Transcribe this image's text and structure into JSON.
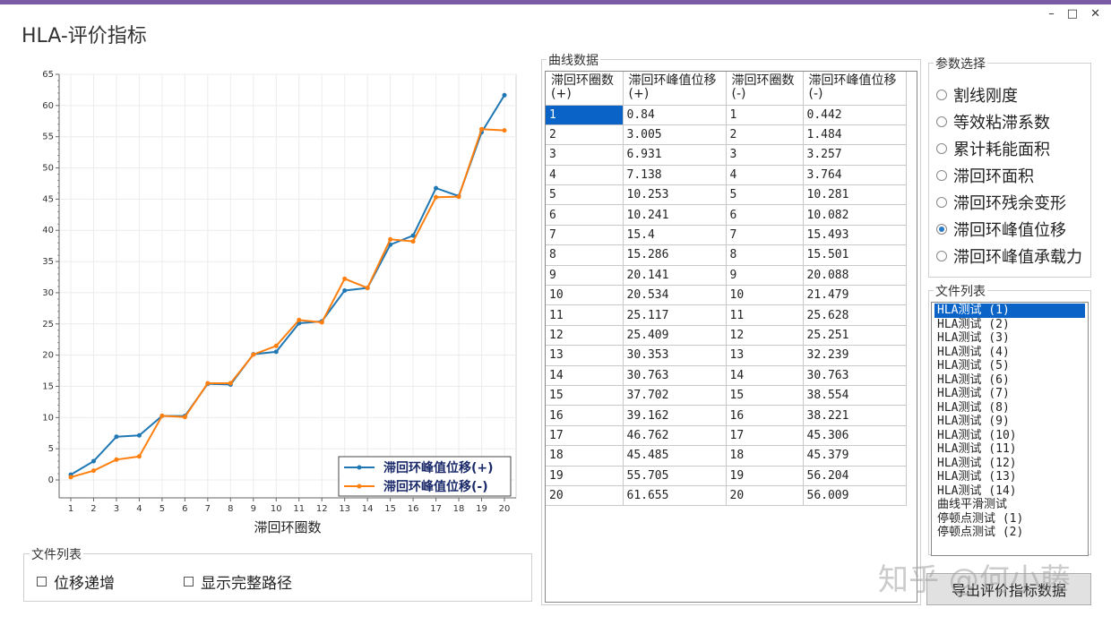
{
  "window": {
    "title": "HLA-评价指标",
    "controls": {
      "minimize": "–",
      "maximize": "□",
      "close": "✕"
    }
  },
  "bottom_group": {
    "label": "文件列表",
    "checkbox1": "位移递增",
    "checkbox2": "显示完整路径"
  },
  "curve_group": {
    "label": "曲线数据",
    "headers": [
      "滞回环圈数(+)",
      "滞回环峰值位移(+)",
      "滞回环圈数(-)",
      "滞回环峰值位移(-)"
    ],
    "rows": [
      [
        "1",
        "0.84",
        "1",
        "0.442"
      ],
      [
        "2",
        "3.005",
        "2",
        "1.484"
      ],
      [
        "3",
        "6.931",
        "3",
        "3.257"
      ],
      [
        "4",
        "7.138",
        "4",
        "3.764"
      ],
      [
        "5",
        "10.253",
        "5",
        "10.281"
      ],
      [
        "6",
        "10.241",
        "6",
        "10.082"
      ],
      [
        "7",
        "15.4",
        "7",
        "15.493"
      ],
      [
        "8",
        "15.286",
        "8",
        "15.501"
      ],
      [
        "9",
        "20.141",
        "9",
        "20.088"
      ],
      [
        "10",
        "20.534",
        "10",
        "21.479"
      ],
      [
        "11",
        "25.117",
        "11",
        "25.628"
      ],
      [
        "12",
        "25.409",
        "12",
        "25.251"
      ],
      [
        "13",
        "30.353",
        "13",
        "32.239"
      ],
      [
        "14",
        "30.763",
        "14",
        "30.763"
      ],
      [
        "15",
        "37.702",
        "15",
        "38.554"
      ],
      [
        "16",
        "39.162",
        "16",
        "38.221"
      ],
      [
        "17",
        "46.762",
        "17",
        "45.306"
      ],
      [
        "18",
        "45.485",
        "18",
        "45.379"
      ],
      [
        "19",
        "55.705",
        "19",
        "56.204"
      ],
      [
        "20",
        "61.655",
        "20",
        "56.009"
      ]
    ]
  },
  "param_group": {
    "label": "参数选择",
    "options": [
      "割线刚度",
      "等效粘滞系数",
      "累计耗能面积",
      "滞回环面积",
      "滞回环残余变形",
      "滞回环峰值位移",
      "滞回环峰值承载力"
    ],
    "selected_index": 5
  },
  "file_list": {
    "label": "文件列表",
    "items": [
      "HLA测试 (1)",
      "HLA测试 (2)",
      "HLA测试 (3)",
      "HLA测试 (4)",
      "HLA测试 (5)",
      "HLA测试 (6)",
      "HLA测试 (7)",
      "HLA测试 (8)",
      "HLA测试 (9)",
      "HLA测试 (10)",
      "HLA测试 (11)",
      "HLA测试 (12)",
      "HLA测试 (13)",
      "HLA测试 (14)",
      "曲线平滑测试",
      "停顿点测试 (1)",
      "停顿点测试 (2)"
    ],
    "selected_index": 0
  },
  "export_button": "导出评价指标数据",
  "watermark": "知乎 @何小藤",
  "colors": {
    "series_pos": "#1f77b4",
    "series_neg": "#ff7f0e",
    "selection": "#0a64c8",
    "title_bar": "#7b5aa6"
  },
  "chart_data": {
    "type": "line",
    "xlabel": "滞回环圈数",
    "ylabel": "",
    "x": [
      1,
      2,
      3,
      4,
      5,
      6,
      7,
      8,
      9,
      10,
      11,
      12,
      13,
      14,
      15,
      16,
      17,
      18,
      19,
      20
    ],
    "xlim": [
      1,
      20
    ],
    "ylim": [
      0,
      65
    ],
    "yticks": [
      0,
      5,
      10,
      15,
      20,
      25,
      30,
      35,
      40,
      45,
      50,
      55,
      60,
      65
    ],
    "grid": true,
    "legend_position": "bottom-right",
    "series": [
      {
        "name": "滞回环峰值位移(+)",
        "color": "#1f77b4",
        "values": [
          0.84,
          3.005,
          6.931,
          7.138,
          10.253,
          10.241,
          15.4,
          15.286,
          20.141,
          20.534,
          25.117,
          25.409,
          30.353,
          30.763,
          37.702,
          39.162,
          46.762,
          45.485,
          55.705,
          61.655
        ]
      },
      {
        "name": "滞回环峰值位移(-)",
        "color": "#ff7f0e",
        "values": [
          0.442,
          1.484,
          3.257,
          3.764,
          10.281,
          10.082,
          15.493,
          15.501,
          20.088,
          21.479,
          25.628,
          25.251,
          32.239,
          30.763,
          38.554,
          38.221,
          45.306,
          45.379,
          56.204,
          56.009
        ]
      }
    ]
  }
}
